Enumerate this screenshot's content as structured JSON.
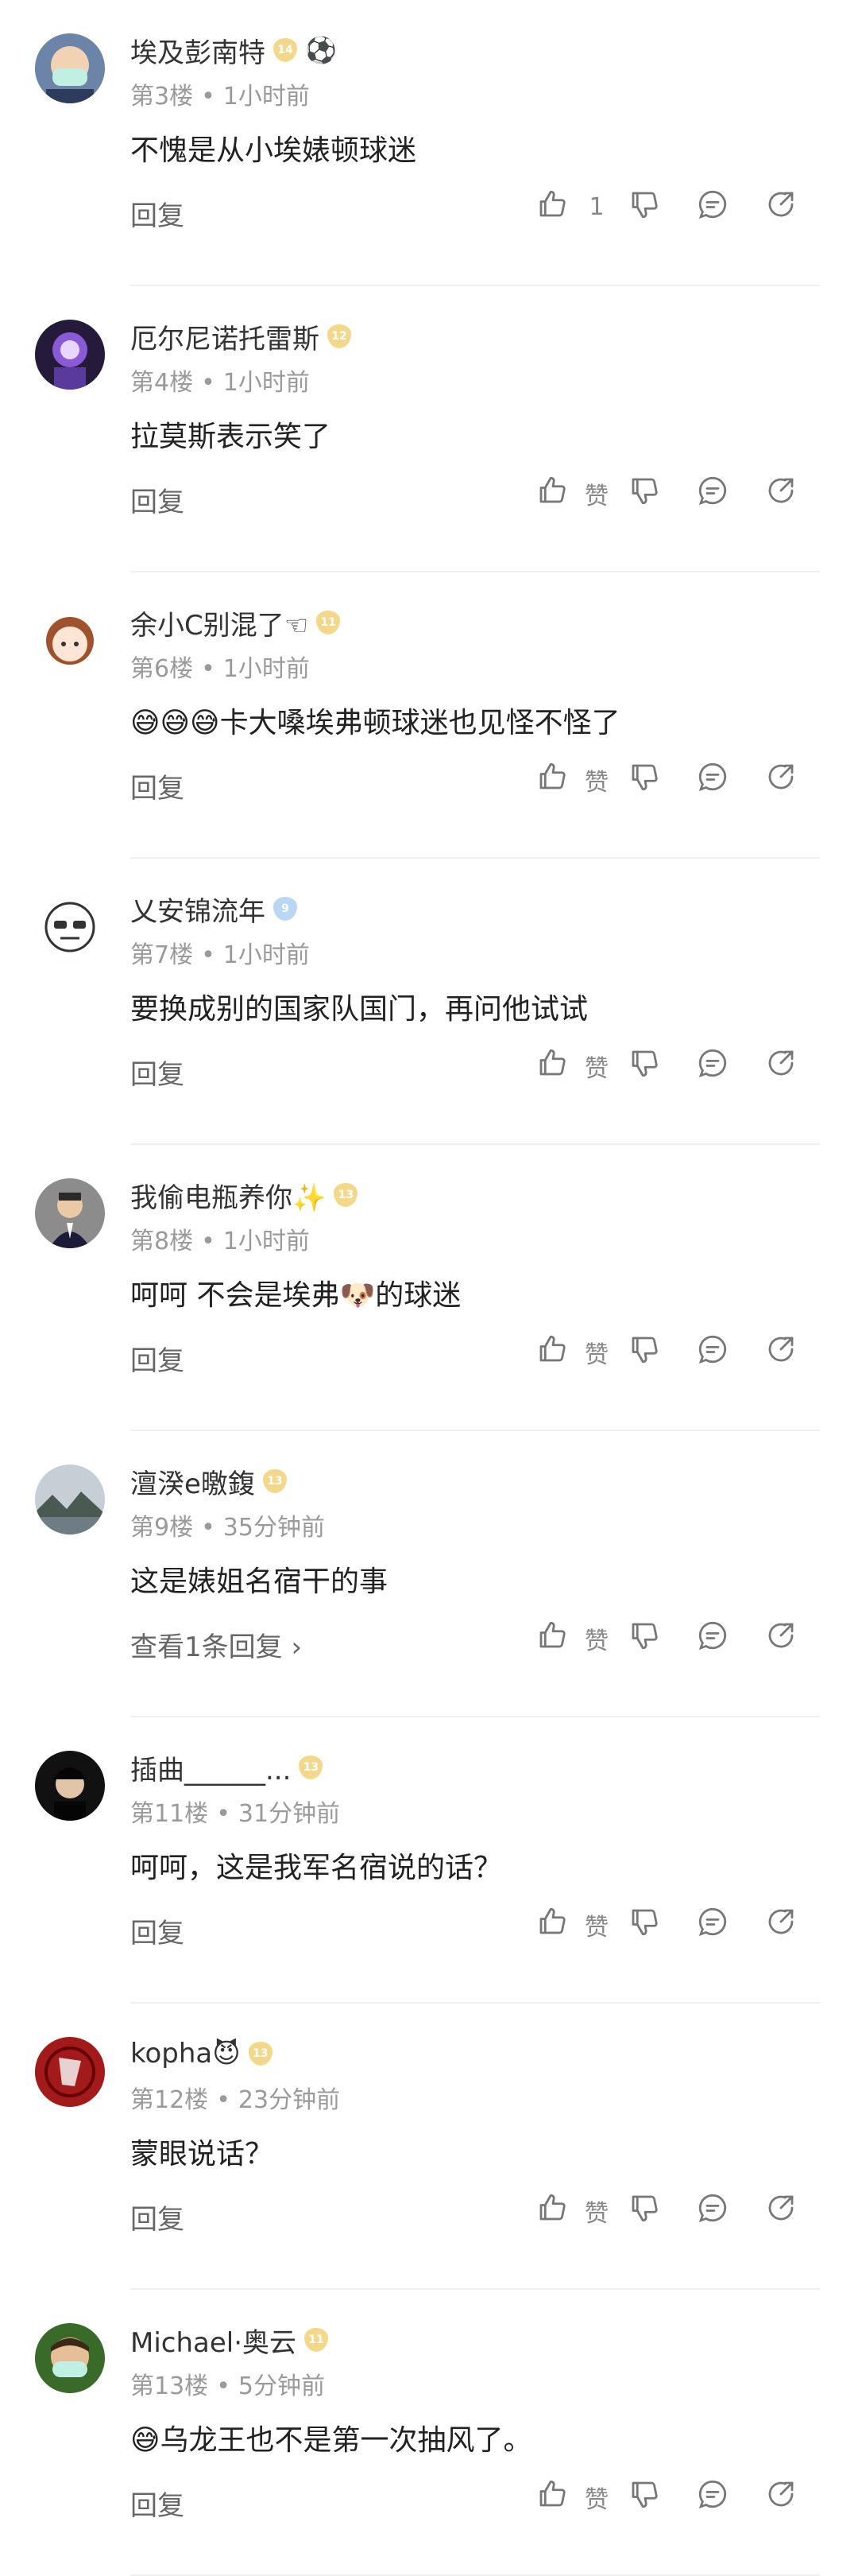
{
  "comments": [
    {
      "username": "埃及彭南特",
      "badge": "14",
      "badge_color": "gold",
      "flair": "⚽",
      "floor": "第3楼",
      "time": "1小时前",
      "text": "不愧是从小埃婊顿球迷",
      "reply_label": "回复",
      "like_label": "1",
      "avatar_icon": "avatar-masked-person"
    },
    {
      "username": "厄尔尼诺托雷斯",
      "badge": "12",
      "badge_color": "gold",
      "flair": "",
      "floor": "第4楼",
      "time": "1小时前",
      "text": "拉莫斯表示笑了",
      "reply_label": "回复",
      "like_label": "赞",
      "avatar_icon": "avatar-purple-figure"
    },
    {
      "username": "余小C别混了☜",
      "badge": "11",
      "badge_color": "gold",
      "flair": "",
      "floor": "第6楼",
      "time": "1小时前",
      "text": "😅😅😅卡大嗓埃弗顿球迷也见怪不怪了",
      "reply_label": "回复",
      "like_label": "赞",
      "avatar_icon": "avatar-anime-girl"
    },
    {
      "username": "乂安锦流年",
      "badge": "9",
      "badge_color": "blue",
      "flair": "",
      "floor": "第7楼",
      "time": "1小时前",
      "text": "要换成别的国家队国门，再问他试试",
      "reply_label": "回复",
      "like_label": "赞",
      "avatar_icon": "avatar-sunglasses-face"
    },
    {
      "username": "我偷电瓶养你✨",
      "badge": "13",
      "badge_color": "gold",
      "flair": "",
      "floor": "第8楼",
      "time": "1小时前",
      "text": "呵呵 不会是埃弗🐶的球迷",
      "reply_label": "回复",
      "like_label": "赞",
      "avatar_icon": "avatar-suited-man"
    },
    {
      "username": "澶湀e曒鍑",
      "badge": "13",
      "badge_color": "gold",
      "flair": "",
      "floor": "第9楼",
      "time": "35分钟前",
      "text": "这是婊姐名宿干的事",
      "reply_label": "查看1条回复 ›",
      "like_label": "赞",
      "avatar_icon": "avatar-landscape"
    },
    {
      "username": "插曲______...",
      "badge": "13",
      "badge_color": "gold",
      "flair": "",
      "floor": "第11楼",
      "time": "31分钟前",
      "text": "呵呵，这是我军名宿说的话？",
      "reply_label": "回复",
      "like_label": "赞",
      "avatar_icon": "avatar-dark-person"
    },
    {
      "username": "kopha😈",
      "badge": "13",
      "badge_color": "gold",
      "flair": "",
      "floor": "第12楼",
      "time": "23分钟前",
      "text": "蒙眼说话？",
      "reply_label": "回复",
      "like_label": "赞",
      "avatar_icon": "avatar-red-logo"
    },
    {
      "username": "Michael·奥云",
      "badge": "11",
      "badge_color": "gold",
      "flair": "",
      "floor": "第13楼",
      "time": "5分钟前",
      "text": "😅乌龙王也不是第一次抽风了。",
      "reply_label": "回复",
      "like_label": "赞",
      "avatar_icon": "avatar-smiling-man"
    }
  ],
  "colors": {
    "text": "#222222",
    "meta": "#9a9a9a",
    "icon": "#777777",
    "badge_gold": "#f4d88a",
    "badge_blue": "#b9d7f2"
  },
  "icons": [
    "thumbs-up-icon",
    "thumbs-down-icon",
    "comment-icon",
    "share-icon"
  ]
}
